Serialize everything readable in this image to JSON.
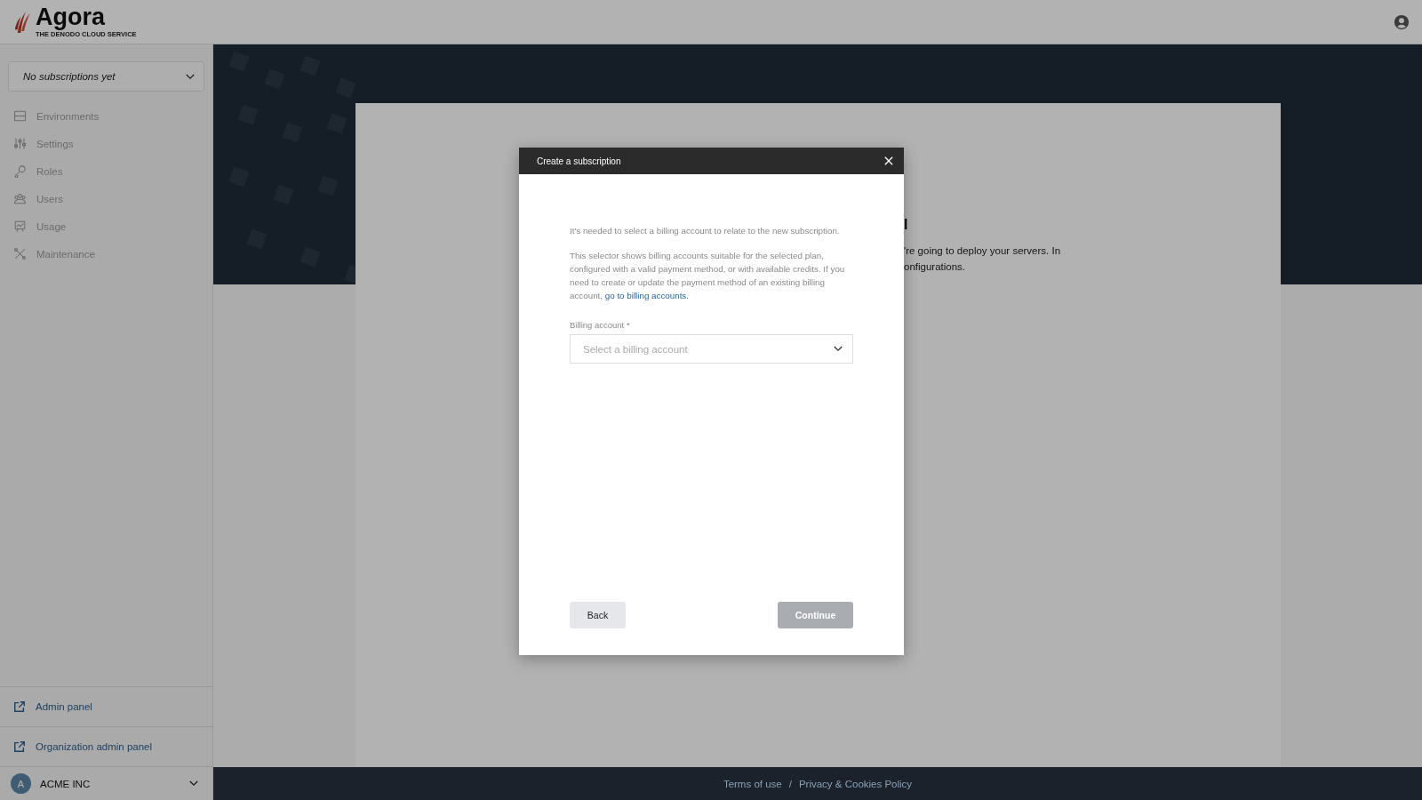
{
  "header": {
    "logo": "Agora",
    "tagline": "THE DENODO CLOUD SERVICE"
  },
  "sidebar": {
    "subscription_select": "No subscriptions yet",
    "items": [
      {
        "label": "Environments",
        "kind": "environments",
        "disabled": true
      },
      {
        "label": "Settings",
        "kind": "settings",
        "disabled": true
      },
      {
        "label": "Roles",
        "kind": "roles",
        "disabled": true
      },
      {
        "label": "Users",
        "kind": "users",
        "disabled": true
      },
      {
        "label": "Usage",
        "kind": "usage",
        "disabled": true
      },
      {
        "label": "Maintenance",
        "kind": "maintenance",
        "disabled": true
      }
    ],
    "links": [
      "Admin panel",
      "Organization admin panel"
    ],
    "organization": {
      "initial": "A",
      "name": "ACME INC"
    }
  },
  "background_card": {
    "heading_fragment": "l",
    "lines": [
      "'re going to deploy your servers. In",
      "onfigurations."
    ]
  },
  "dialog": {
    "title": "Create a subscription",
    "intro": "It's needed to select a billing account to relate to the new subscription.",
    "paragraph": "This selector shows billing accounts suitable for the selected plan, configured with a valid payment method, or with available credits. If you need to create or update the payment method of an existing billing account,",
    "link": "go to billing accounts.",
    "field_label": "Billing account *",
    "placeholder": "Select a billing account",
    "buttons": [
      {
        "label": "Back",
        "disabled": false
      },
      {
        "label": "Continue",
        "disabled": true
      }
    ]
  },
  "footer": [
    "Terms of use",
    "/",
    "Privacy & Cookies Policy"
  ]
}
